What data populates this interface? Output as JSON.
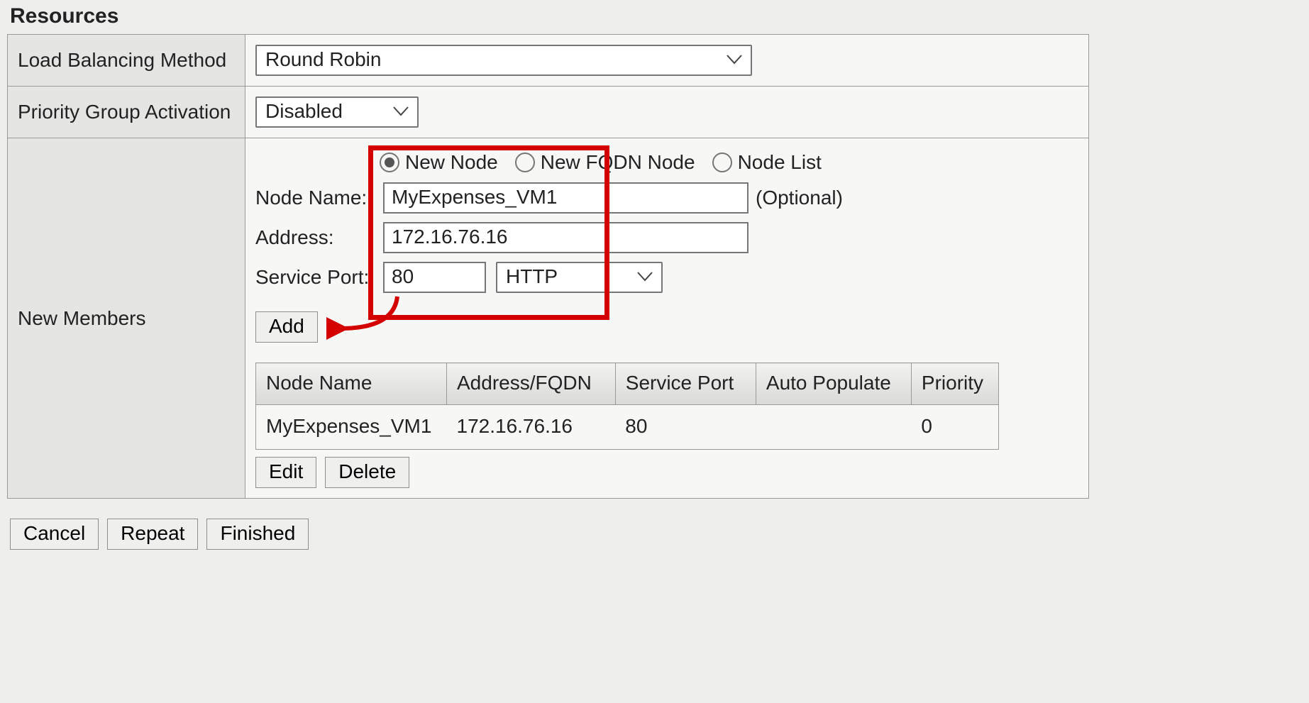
{
  "section_title": "Resources",
  "rows": {
    "lbm_label": "Load Balancing Method",
    "lbm_value": "Round Robin",
    "pga_label": "Priority Group Activation",
    "pga_value": "Disabled",
    "members_label": "New Members"
  },
  "node_form": {
    "radios": {
      "new_node": "New Node",
      "new_fqdn": "New FQDN Node",
      "node_list": "Node List"
    },
    "labels": {
      "node_name": "Node Name:",
      "optional": "(Optional)",
      "address": "Address:",
      "service_port": "Service Port:"
    },
    "values": {
      "node_name": "MyExpenses_VM1",
      "address": "172.16.76.16",
      "port": "80",
      "port_proto": "HTTP"
    },
    "add_btn": "Add"
  },
  "members_table": {
    "headers": {
      "node_name": "Node Name",
      "address": "Address/FQDN",
      "service_port": "Service Port",
      "auto_populate": "Auto Populate",
      "priority": "Priority"
    },
    "row0": {
      "node_name": "MyExpenses_VM1",
      "address": "172.16.76.16",
      "service_port": "80",
      "auto_populate": "",
      "priority": "0"
    },
    "edit_btn": "Edit",
    "delete_btn": "Delete"
  },
  "page_buttons": {
    "cancel": "Cancel",
    "repeat": "Repeat",
    "finished": "Finished"
  }
}
